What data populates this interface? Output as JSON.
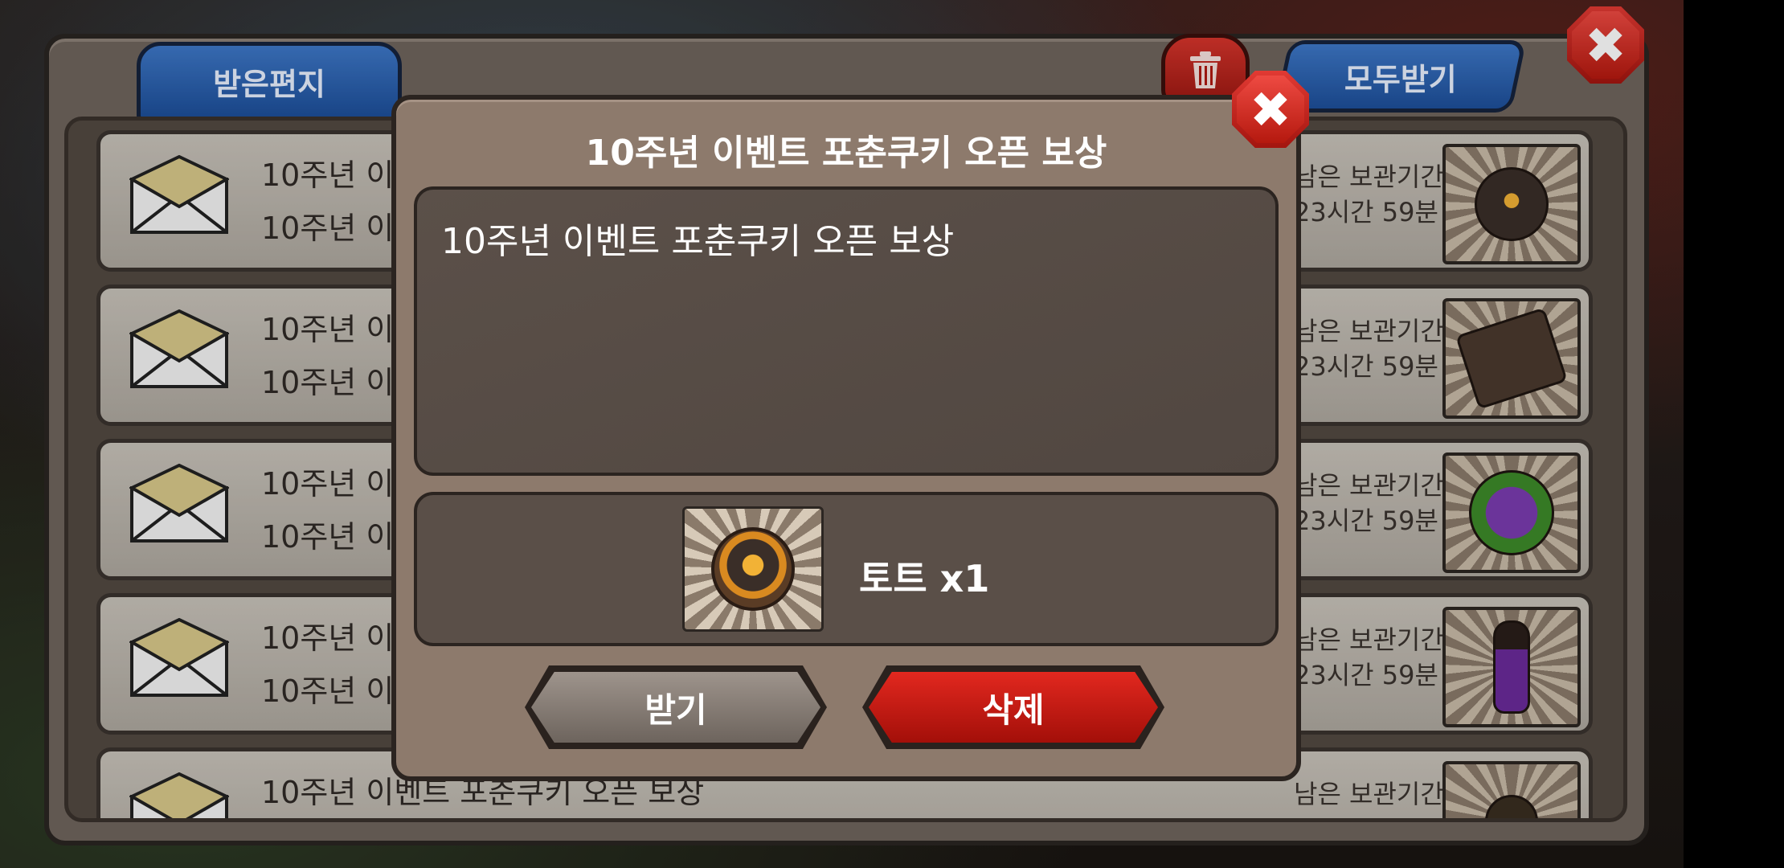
{
  "tabs": {
    "received": "받은편지",
    "receive_all": "모두받기"
  },
  "icons": {
    "trash": "trash-icon",
    "close": "close-icon",
    "envelope": "envelope-icon"
  },
  "mail_rows": [
    {
      "title": "10주년 이벤트 포춘쿠키 오픈 보상",
      "sub": "10주년 이벤트 포춘쿠키 오픈 보상",
      "expire_label": "남은 보관기간",
      "expire_value": "23시간 59분",
      "item_icon": "helmet-icon"
    },
    {
      "title": "10주년 이벤트 포춘쿠키 오픈 보상",
      "sub": "10주년 이벤트 포춘쿠키 오픈 보상",
      "expire_label": "남은 보관기간",
      "expire_value": "23시간 59분",
      "item_icon": "armor-icon"
    },
    {
      "title": "10주년 이벤트 포춘쿠키 오픈 보상",
      "sub": "10주년 이벤트 포춘쿠키 오픈 보상",
      "expire_label": "남은 보관기간",
      "expire_value": "23시간 59분",
      "item_icon": "level-up-icon"
    },
    {
      "title": "10주년 이벤트 포춘쿠키 오픈 보상",
      "sub": "10주년 이벤트 포춘쿠키 오픈 보상",
      "expire_label": "남은 보관기간",
      "expire_value": "23시간 59분",
      "item_icon": "potion-icon"
    },
    {
      "title": "10주년 이벤트 포춘쿠키 오픈 보상",
      "sub": "",
      "expire_label": "남은 보관기간",
      "expire_value": "",
      "item_icon": "lamp-icon"
    }
  ],
  "popup": {
    "title": "10주년 이벤트 포춘쿠키 오픈 보상",
    "body": "10주년 이벤트 포춘쿠키 오픈 보상",
    "reward_label": "토트 x1",
    "reward_icon": "crown-icon",
    "receive_button": "받기",
    "delete_button": "삭제"
  },
  "colors": {
    "tab_blue": "#2a63b3",
    "delete_red": "#c81a12",
    "panel_brown": "#8d7a6c"
  }
}
